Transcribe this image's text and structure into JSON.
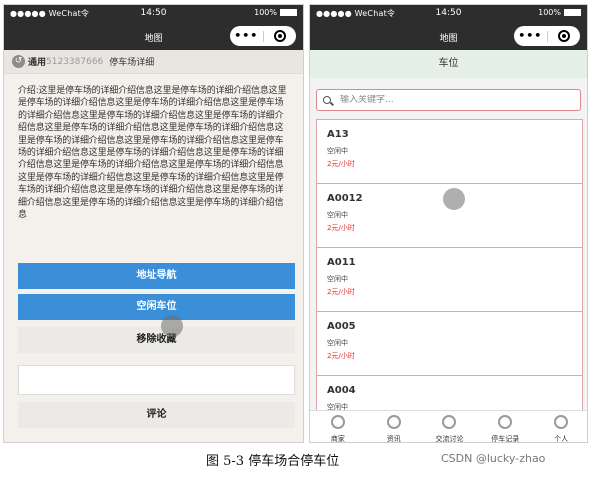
{
  "status_bar": {
    "carrier": "●●●●● WeChat令",
    "time": "14:50",
    "battery": "100%"
  },
  "left": {
    "nav_title": "地图",
    "capsule_more": "•••",
    "subheader": {
      "user": "通用",
      "phone": "5123387666",
      "title": "停车场详细"
    },
    "intro": "介绍:这里是停车场的详细介绍信息这里是停车场的详细介绍信息这里是停车场的详细介绍信息这里是停车场的详细介绍信息这里是停车场的详细介绍信息这里是停车场的详细介绍信息这里是停车场的详细介绍信息这里是停车场的详细介绍信息这里是停车场的详细介绍信息这里是停车场的详细介绍信息这里是停车场的详细介绍信息这里是停车场的详细介绍信息这里是停车场的详细介绍信息这里是停车场的详细介绍信息这里是停车场的详细介绍信息这里是停车场的详细介绍信息这里是停车场的详细介绍信息这里是停车场的详细介绍信息这里是停车场的详细介绍信息这里是停车场的详细介绍信息这里是停车场的详细介绍信息这里是停车场的详细介绍信息这里是停车场的详细介绍信息",
    "buttons": {
      "navigate": "地址导航",
      "vacant": "空闲车位",
      "remove": "移除收藏",
      "comment": "评论"
    },
    "comment_value": ""
  },
  "right": {
    "nav_title": "地图",
    "capsule_more": "•••",
    "page_title": "车位",
    "search_placeholder": "输入关键字...",
    "spots": [
      {
        "name": "A13",
        "status": "空闲中",
        "price": "2元/小时"
      },
      {
        "name": "A0012",
        "status": "空闲中",
        "price": "2元/小时"
      },
      {
        "name": "A011",
        "status": "空闲中",
        "price": "2元/小时"
      },
      {
        "name": "A005",
        "status": "空闲中",
        "price": "2元/小时"
      },
      {
        "name": "A004",
        "status": "空闲中",
        "price": ""
      }
    ],
    "tabs": [
      {
        "label": "商家",
        "icon": "store-icon"
      },
      {
        "label": "资讯",
        "icon": "news-icon"
      },
      {
        "label": "交流讨论",
        "icon": "discussion-icon"
      },
      {
        "label": "停车记录",
        "icon": "parking-record-icon"
      },
      {
        "label": "个人",
        "icon": "person-icon"
      }
    ]
  },
  "caption": "图 5-3 停车场合停车位",
  "watermark": "CSDN @lucky-zhao",
  "colors": {
    "accent_blue": "#3a8fd8",
    "price_red": "#dd3333",
    "dark_bar": "#2d2d2d"
  }
}
